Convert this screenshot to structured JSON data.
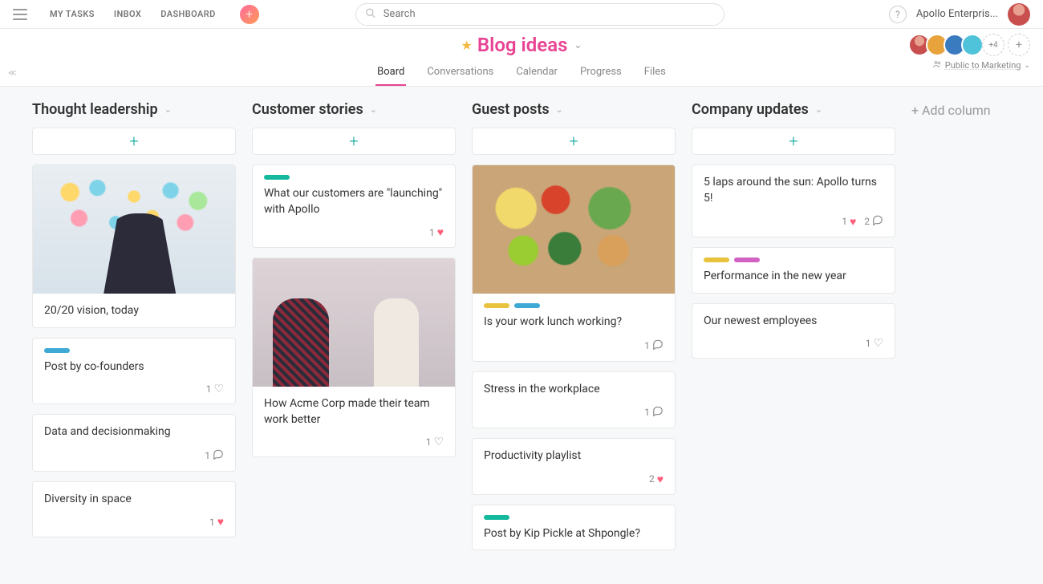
{
  "topbar": {
    "nav": [
      "MY TASKS",
      "INBOX",
      "DASHBOARD"
    ],
    "search_placeholder": "Search",
    "workspace": "Apollo Enterpris..."
  },
  "project": {
    "title": "Blog ideas",
    "tabs": [
      "Board",
      "Conversations",
      "Calendar",
      "Progress",
      "Files"
    ],
    "active_tab": 0,
    "member_extra": "+4",
    "privacy": "Public to Marketing",
    "member_colors": [
      "#c94f4f",
      "#e8a33d",
      "#3a7bbf",
      "#4fc3d9"
    ]
  },
  "add_column_label": "+ Add column",
  "columns": [
    {
      "title": "Thought leadership",
      "cards": [
        {
          "image": "stickies",
          "title": "20/20 vision, today"
        },
        {
          "tags": [
            "#3fa9d6"
          ],
          "title": "Post by co-founders",
          "likes": 1
        },
        {
          "title": "Data and decisionmaking",
          "comments": 1
        },
        {
          "title": "Diversity in space",
          "likes": 1,
          "liked": true
        }
      ]
    },
    {
      "title": "Customer stories",
      "cards": [
        {
          "tags": [
            "#14b89c"
          ],
          "title": "What our customers are \"launching\" with Apollo",
          "likes": 1,
          "liked": true
        },
        {
          "image": "meeting",
          "title": "How Acme Corp made their team work better",
          "likes": 1
        }
      ]
    },
    {
      "title": "Guest posts",
      "cards": [
        {
          "image": "food",
          "tags": [
            "#e8c23d",
            "#3fa9d6"
          ],
          "title": "Is your work lunch working?",
          "comments": 1
        },
        {
          "title": "Stress in the workplace",
          "comments": 1
        },
        {
          "title": "Productivity playlist",
          "likes": 2,
          "liked": true
        },
        {
          "tags": [
            "#14b89c"
          ],
          "title": "Post by Kip Pickle at Shpongle?"
        }
      ]
    },
    {
      "title": "Company updates",
      "cards": [
        {
          "title": "5 laps around the sun: Apollo turns 5!",
          "likes": 1,
          "liked": true,
          "comments": 2
        },
        {
          "tags": [
            "#e8c23d",
            "#d162c4"
          ],
          "title": "Performance in the new year"
        },
        {
          "title": "Our newest employees",
          "likes": 1
        }
      ]
    }
  ]
}
